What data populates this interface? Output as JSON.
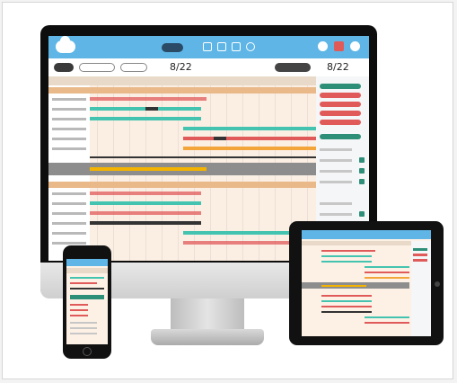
{
  "desktop": {
    "date_main": "8/22",
    "date_side": "8/22"
  },
  "colors": {
    "topbar": "#5fb6e6",
    "bar_teal": "#44c4b0",
    "bar_red": "#e05a5a",
    "bar_orange": "#f4a53a",
    "bar_dark": "#333333",
    "bar_yellow": "#f3b300",
    "group_header": "#e9b98a",
    "side_green": "#2e8f78"
  }
}
